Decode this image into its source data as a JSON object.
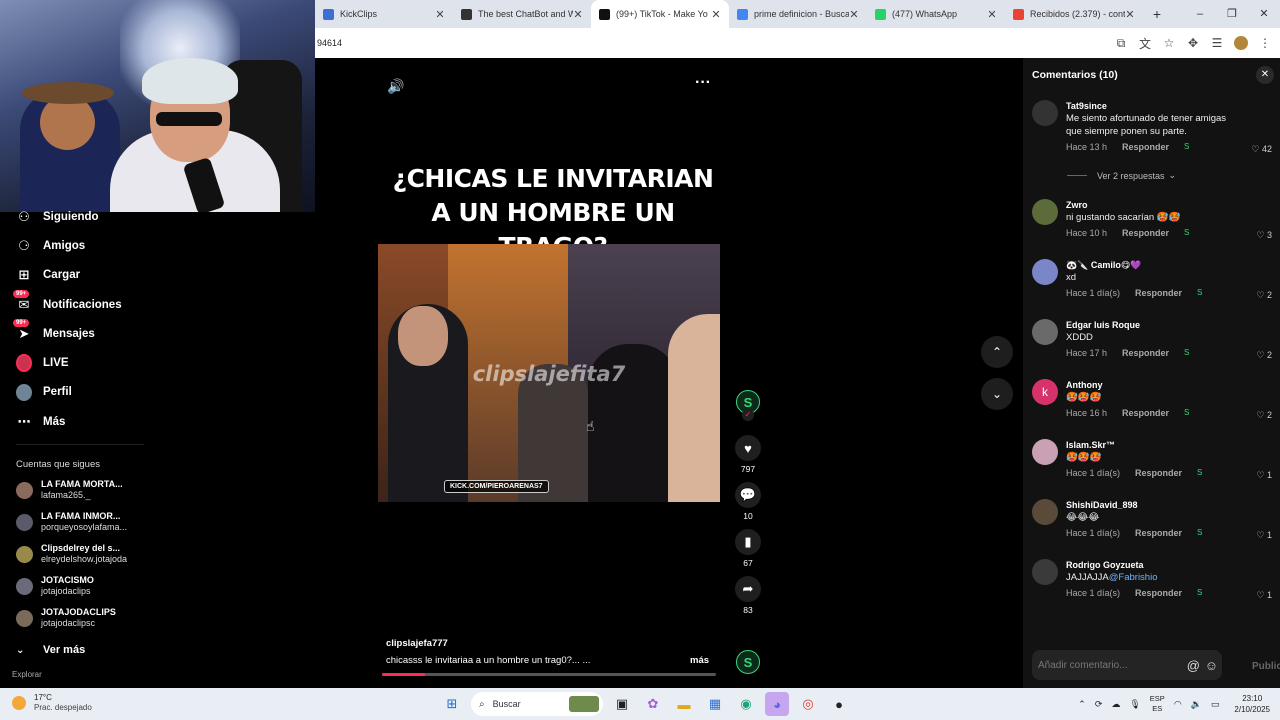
{
  "browser": {
    "tabs": [
      {
        "title": "KickClips",
        "favicon_color": "#3b6fd4"
      },
      {
        "title": "The best ChatBot and Wi",
        "favicon_color": "#333333"
      },
      {
        "title": "(99+) TikTok - Make Yo",
        "favicon_color": "#111111",
        "active": true
      },
      {
        "title": "prime definicion - Buscar",
        "favicon_color": "#4285f4"
      },
      {
        "title": "(477) WhatsApp",
        "favicon_color": "#25d366"
      },
      {
        "title": "Recibidos (2.379) - conta",
        "favicon_color": "#ea4335"
      }
    ],
    "url": "94614",
    "new_tab": "+",
    "window_controls": [
      "–",
      "❐",
      "✕"
    ]
  },
  "sidebar": {
    "nav": [
      {
        "label": "Siguiendo",
        "icon": "following-icon"
      },
      {
        "label": "Amigos",
        "icon": "friends-icon"
      },
      {
        "label": "Cargar",
        "icon": "upload-icon"
      },
      {
        "label": "Notificaciones",
        "icon": "inbox-icon",
        "badge": "99+"
      },
      {
        "label": "Mensajes",
        "icon": "messages-icon",
        "badge": "99+"
      },
      {
        "label": "LIVE",
        "icon": "live-icon"
      },
      {
        "label": "Perfil",
        "icon": "profile-icon"
      },
      {
        "label": "Más",
        "icon": "more-icon"
      }
    ],
    "following_title": "Cuentas que sigues",
    "accounts": [
      {
        "name": "LA FAMA MORTA...",
        "handle": "lafama265._",
        "color": "#8a6a5a"
      },
      {
        "name": "LA FAMA INMOR...",
        "handle": "porqueyosoylafama...",
        "color": "#5a5a6a"
      },
      {
        "name": "Clipsdelrey del s...",
        "handle": "elreydelshow.jotajoda",
        "color": "#9a8a4a"
      },
      {
        "name": "JOTACISMO",
        "handle": "jotajodaclips",
        "color": "#6a6a7a"
      },
      {
        "name": "JOTAJODACLIPS",
        "handle": "jotajodaclipsc",
        "color": "#7a6a5a"
      }
    ],
    "see_more": "Ver más",
    "explore_cut": "Explorar"
  },
  "video": {
    "headline_line1": "¿CHICAS LE INVITARIAN",
    "headline_line2": "A UN HOMBRE UN TRAGO?",
    "watermark": "clipslajefita7",
    "kick_tag": "KICK.COM/PIEROARENAS7",
    "author": "clipslajefa777",
    "caption": "chicasss le invitariaa a un hombre un trag0?... ...",
    "more": "más",
    "likes": "797",
    "comments": "10",
    "saves": "67",
    "shares": "83",
    "creator_initial": "S",
    "progress": 0.13
  },
  "comments_panel": {
    "title": "Comentarios (10)",
    "replies_toggle": "Ver 2 respuestas",
    "reply_label": "Responder",
    "input_placeholder": "Añadir comentario...",
    "publish": "Publicar",
    "items": [
      {
        "user": "Tat9since",
        "text": "Me siento afortunado de tener amigas que siempre ponen su parte.",
        "time": "Hace 13 h",
        "likes": "42",
        "avatar_color": "#333333"
      },
      {
        "user": "Zwro",
        "text": "ni gustando sacarían 🥵🥵",
        "time": "Hace 10 h",
        "likes": "3",
        "avatar_color": "#5b6b3a"
      },
      {
        "user": "🐼🔪 Camilo😋💜",
        "text": "xd",
        "time": "Hace 1 día(s)",
        "likes": "2",
        "avatar_color": "#7a86c8"
      },
      {
        "user": "Edgar luis Roque",
        "text": "XDDD",
        "time": "Hace 17 h",
        "likes": "2",
        "avatar_color": "#6a6a6a"
      },
      {
        "user": "Anthony",
        "text": "🥵🥵🥵",
        "time": "Hace 16 h",
        "likes": "2",
        "avatar_color": "#d6336c",
        "initial": "k"
      },
      {
        "user": "Islam.Skr™",
        "text": "🥵🥵🥵",
        "time": "Hace 1 día(s)",
        "likes": "1",
        "avatar_color": "#c9a0b4"
      },
      {
        "user": "ShishiDavid_898",
        "text": "😂😂😂",
        "time": "Hace 1 día(s)",
        "likes": "1",
        "avatar_color": "#5a4a3a"
      },
      {
        "user": "Rodrigo Goyzueta",
        "text": "JAJJAJJA",
        "mention": "@Fabrishio",
        "time": "Hace 1 día(s)",
        "likes": "1",
        "avatar_color": "#3a3a3a"
      }
    ]
  },
  "taskbar": {
    "temp": "17°C",
    "weather": "Prac. despejado",
    "search": "Buscar",
    "lang1": "ESP",
    "lang2": "ES",
    "time": "23:10",
    "date": "2/10/2025"
  }
}
